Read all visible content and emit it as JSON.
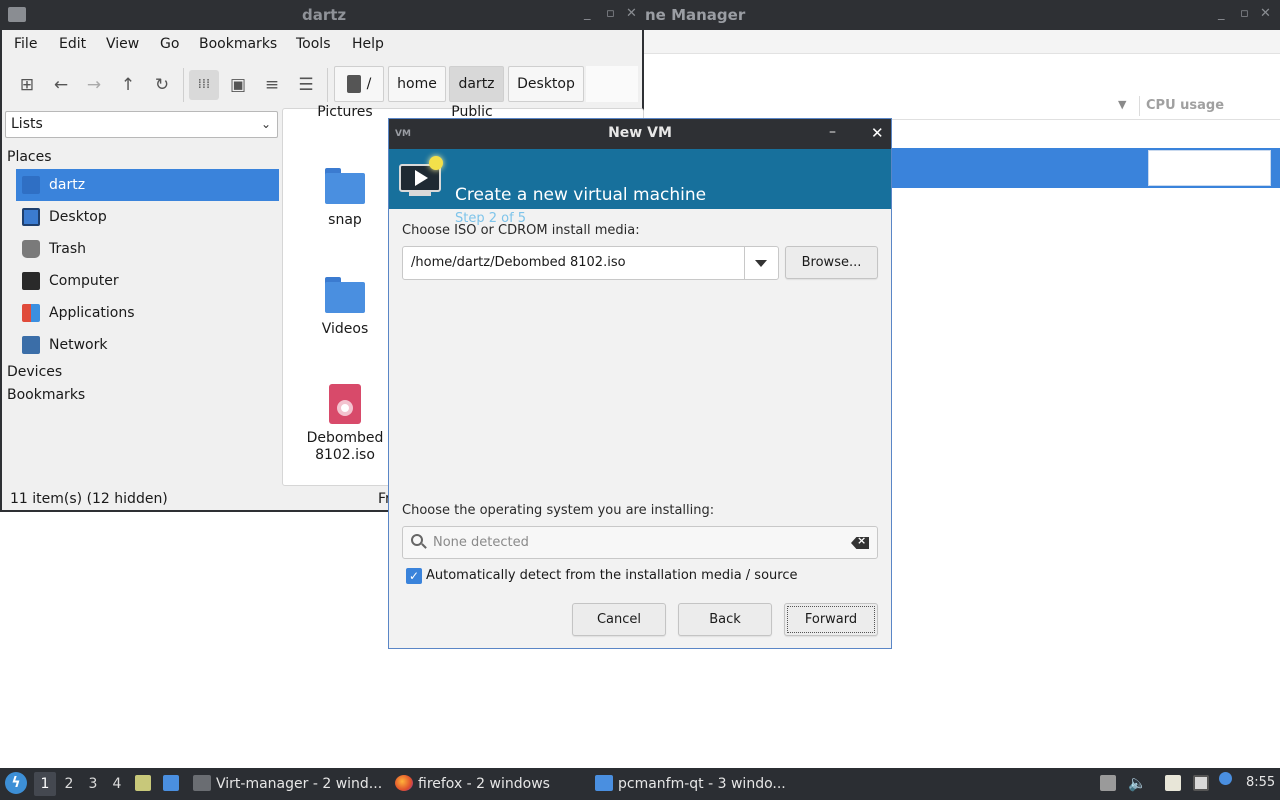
{
  "virt_manager": {
    "title": "ne Manager",
    "columns": {
      "cpu_usage": "CPU usage"
    }
  },
  "file_manager": {
    "title": "dartz",
    "menu": [
      "File",
      "Edit",
      "View",
      "Go",
      "Bookmarks",
      "Tools",
      "Help"
    ],
    "breadcrumbs": [
      "/",
      "home",
      "dartz",
      "Desktop"
    ],
    "sidebar": {
      "view_select": "Lists",
      "places_heading": "Places",
      "places": [
        "dartz",
        "Desktop",
        "Trash",
        "Computer",
        "Applications",
        "Network"
      ],
      "devices_heading": "Devices",
      "bookmarks_heading": "Bookmarks"
    },
    "files": {
      "partial_top": [
        "Pictures",
        "Public"
      ],
      "snap": "snap",
      "videos": "Videos",
      "iso_line1": "Debombed",
      "iso_line2": "8102.iso"
    },
    "status": "11 item(s) (12 hidden)",
    "status_right": "Fr"
  },
  "new_vm_dialog": {
    "title": "New VM",
    "heading": "Create a new virtual machine",
    "step": "Step 2 of 5",
    "media_label": "Choose ISO or CDROM install media:",
    "iso_path": "/home/dartz/Debombed 8102.iso",
    "browse_label": "Browse...",
    "os_label": "Choose the operating system you are installing:",
    "os_placeholder": "None detected",
    "auto_detect_label": "Automatically detect from the installation media / source",
    "auto_detect_checked": true,
    "buttons": {
      "cancel": "Cancel",
      "back": "Back",
      "forward": "Forward"
    }
  },
  "taskbar": {
    "workspaces": [
      "1",
      "2",
      "3",
      "4"
    ],
    "active_workspace": "1",
    "tasks": [
      "Virt-manager - 2 wind...",
      "firefox - 2 windows",
      "pcmanfm-qt - 3 windo..."
    ],
    "clock": "8:55"
  },
  "colors": {
    "selection": "#3a83db",
    "banner": "#17709c",
    "titlebar": "#2e3034",
    "taskbar": "#2b2e33"
  }
}
